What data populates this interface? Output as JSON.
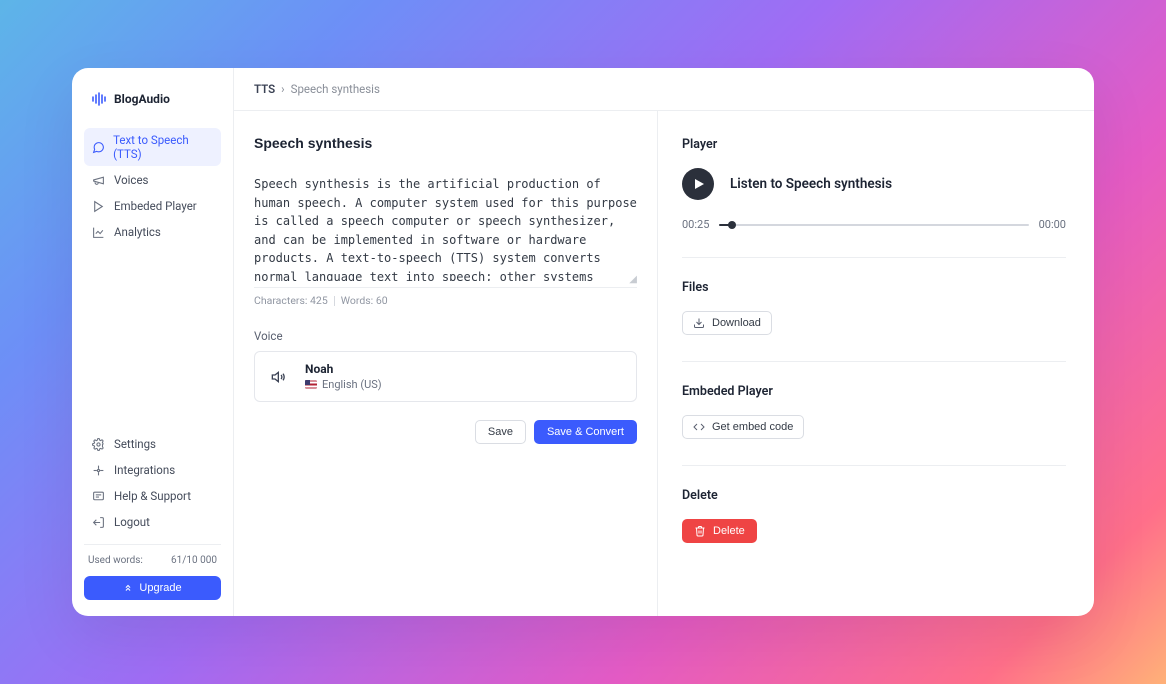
{
  "brand": {
    "name": "BlogAudio"
  },
  "sidebar": {
    "nav": [
      {
        "label": "Text to Speech (TTS)"
      },
      {
        "label": "Voices"
      },
      {
        "label": "Embeded Player"
      },
      {
        "label": "Analytics"
      }
    ],
    "footer": [
      {
        "label": "Settings"
      },
      {
        "label": "Integrations"
      },
      {
        "label": "Help & Support"
      },
      {
        "label": "Logout"
      }
    ],
    "usage_label": "Used words:",
    "usage_value": "61/10 000",
    "upgrade_label": "Upgrade"
  },
  "breadcrumb": {
    "root": "TTS",
    "current": "Speech synthesis"
  },
  "editor": {
    "title": "Speech synthesis",
    "body": "Speech synthesis is the artificial production of human speech. A computer system used for this purpose is called a speech computer or speech synthesizer, and can be implemented in software or hardware products. A text-to-speech (TTS) system converts normal language text into speech; other systems render symbolic linguistic representations like phonetic transcriptions into speech. The reverse process is speech recognition.",
    "char_count_label": "Characters: 425",
    "word_count_label": "Words: 60",
    "voice_section_label": "Voice",
    "voice": {
      "name": "Noah",
      "language": "English (US)"
    },
    "save_label": "Save",
    "save_convert_label": "Save & Convert"
  },
  "player": {
    "section_title": "Player",
    "track_title": "Listen to Speech synthesis",
    "current_time": "00:25",
    "total_time": "00:00"
  },
  "files": {
    "section_title": "Files",
    "download_label": "Download"
  },
  "embed": {
    "section_title": "Embeded Player",
    "get_code_label": "Get embed code"
  },
  "delete": {
    "section_title": "Delete",
    "button_label": "Delete"
  }
}
